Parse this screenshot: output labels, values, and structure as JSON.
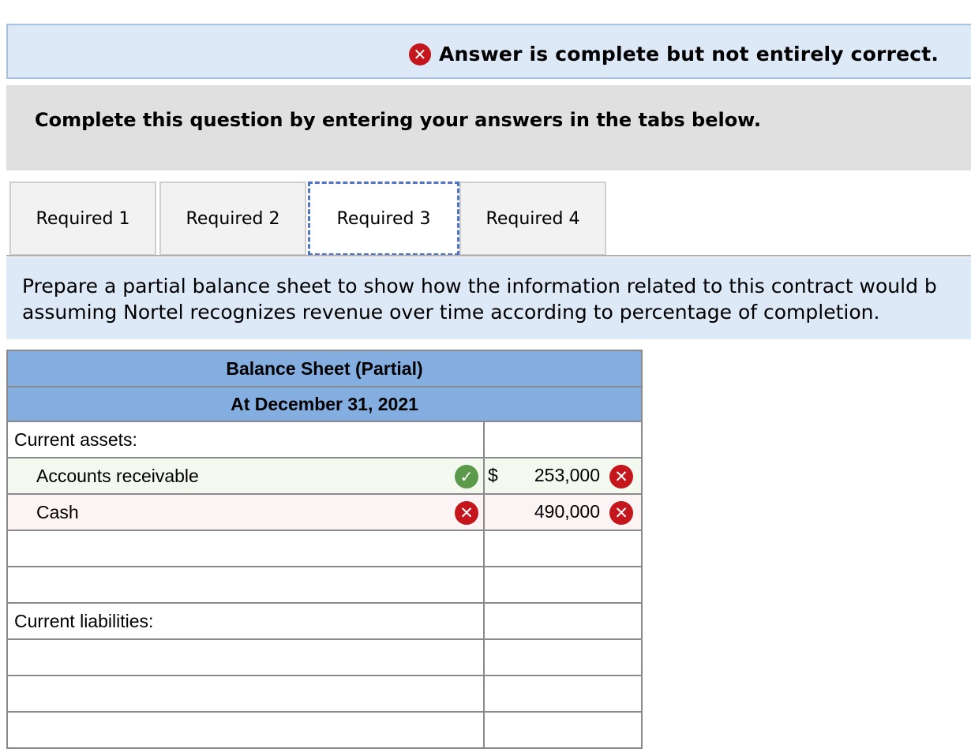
{
  "banner": {
    "message": "Answer is complete but not entirely correct.",
    "icon": "x-circle-icon",
    "status_color": "#c4161c"
  },
  "instructions": "Complete this question by entering your answers in the tabs below.",
  "tabs": [
    {
      "label": "Required 1",
      "active": false
    },
    {
      "label": "Required 2",
      "active": false
    },
    {
      "label": "Required 3",
      "active": true
    },
    {
      "label": "Required 4",
      "active": false
    }
  ],
  "description": {
    "line1": "Prepare a partial balance sheet to show how the information related to this contract would b",
    "line2": "assuming Nortel recognizes revenue over time according to percentage of completion."
  },
  "sheet": {
    "title": "Balance Sheet (Partial)",
    "date": "At December 31, 2021",
    "current_assets_label": "Current assets:",
    "rows": [
      {
        "label": "Accounts receivable",
        "label_status": "correct",
        "currency": "$",
        "value": "253,000",
        "value_status": "incorrect"
      },
      {
        "label": "Cash",
        "label_status": "incorrect",
        "currency": "",
        "value": "490,000",
        "value_status": "incorrect"
      }
    ],
    "current_liabilities_label": "Current liabilities:"
  },
  "colors": {
    "header_bg": "#84aee0",
    "banner_bg": "#dde9f7",
    "correct": "#5a9a4a",
    "incorrect": "#c4161c"
  }
}
